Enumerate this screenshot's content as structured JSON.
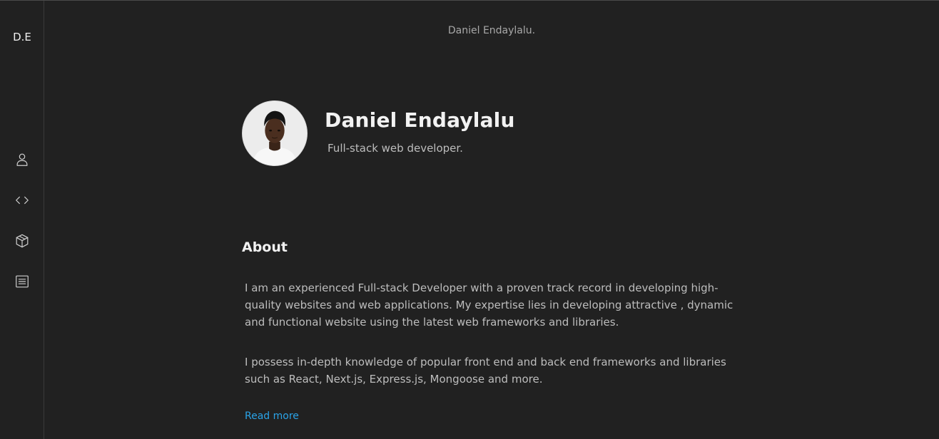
{
  "sidebar": {
    "logo": "D.E",
    "icons": [
      "user-icon",
      "code-icon",
      "package-icon",
      "list-icon"
    ]
  },
  "header": {
    "site_name": "Daniel Endaylalu."
  },
  "hero": {
    "name": "Daniel Endaylalu",
    "role": "Full-stack web developer."
  },
  "about": {
    "title": "About",
    "paragraphs": [
      "I am an experienced Full-stack Developer with a proven track record in developing high-quality websites and web applications. My expertise lies in developing attractive , dynamic and functional website using the latest web frameworks and libraries.",
      "I possess in-depth knowledge of popular front end and back end frameworks and libraries such as React, Next.js, Express.js, Mongoose and more."
    ],
    "read_more": "Read more"
  },
  "colors": {
    "background": "#212121",
    "accent_link": "#2aa3e8",
    "sidebar_border": "#3a3a3a"
  }
}
